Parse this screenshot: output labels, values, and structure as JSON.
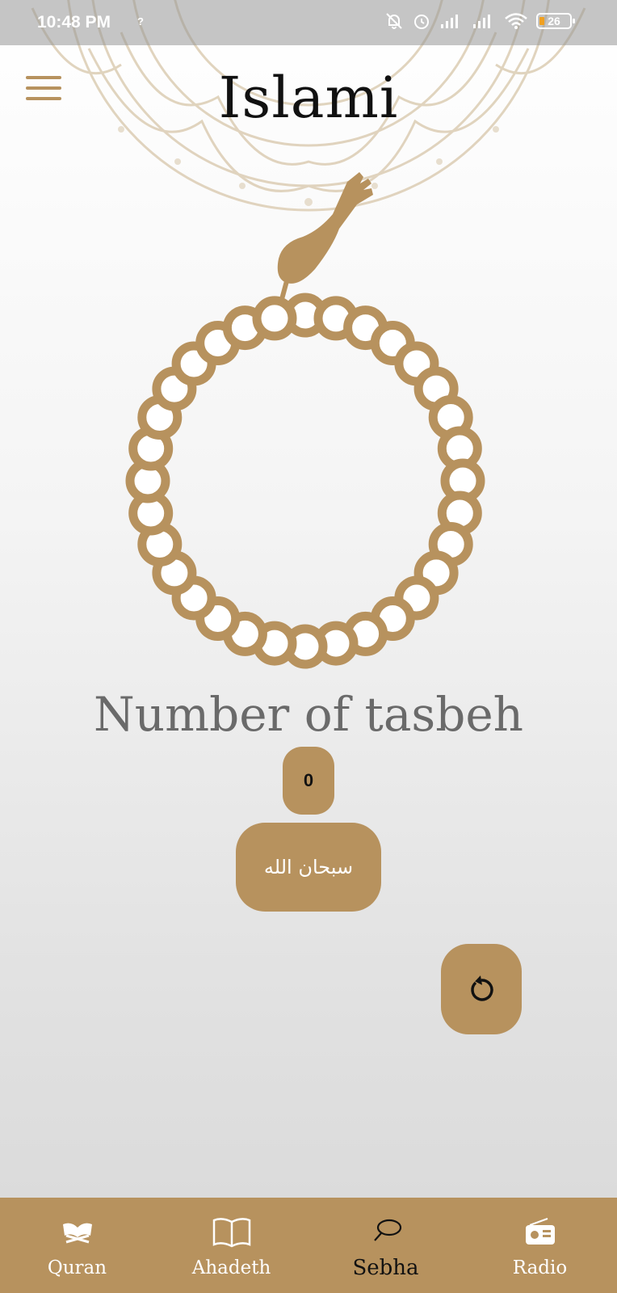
{
  "status_bar": {
    "time": "10:48 PM",
    "question_mark": "?",
    "battery": "26",
    "icons": [
      "mute-icon",
      "alarm-icon",
      "signal-icon",
      "signal-icon",
      "wifi-icon",
      "battery-icon"
    ]
  },
  "header": {
    "title": "Islami",
    "menu_icon": "hamburger-menu-icon"
  },
  "sebha": {
    "heading": "Number of tasbeh",
    "count": "0",
    "zikr": "سبحان الله",
    "reset_icon": "reset-icon"
  },
  "bottom_nav": {
    "items": [
      {
        "label": "Quran",
        "icon": "quran-icon",
        "active": false
      },
      {
        "label": "Ahadeth",
        "icon": "book-icon",
        "active": false
      },
      {
        "label": "Sebha",
        "icon": "sebha-icon",
        "active": true
      },
      {
        "label": "Radio",
        "icon": "radio-icon",
        "active": false
      }
    ]
  },
  "colors": {
    "accent": "#b7925e",
    "title_text": "#111111",
    "heading_text": "#6a6a6a"
  }
}
